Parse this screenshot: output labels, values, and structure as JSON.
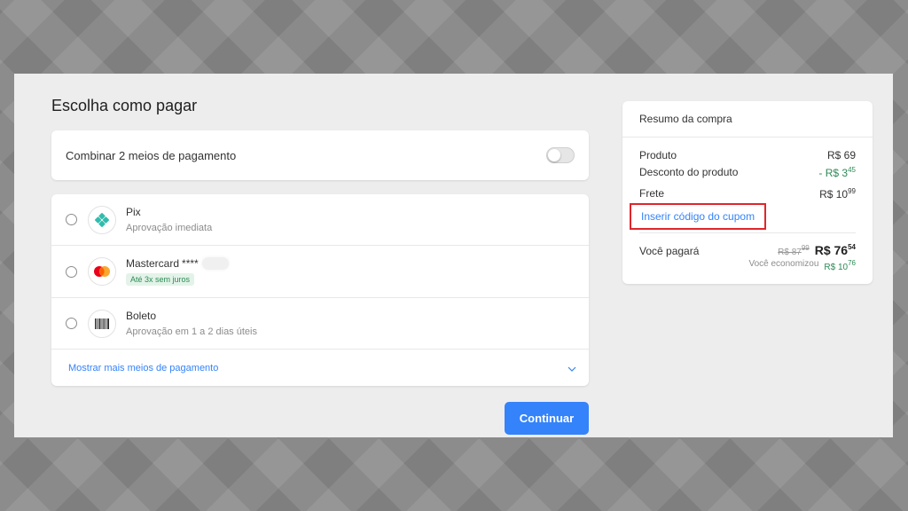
{
  "page": {
    "title": "Escolha como pagar"
  },
  "combine": {
    "label": "Combinar 2 meios de pagamento",
    "enabled": false
  },
  "methods": [
    {
      "name": "Pix",
      "subtitle": "Aprovação imediata",
      "icon": "pix-icon"
    },
    {
      "name": "Mastercard",
      "mask": "****",
      "badge": "Até 3x sem juros",
      "icon": "mastercard-icon"
    },
    {
      "name": "Boleto",
      "subtitle": "Aprovação em 1 a 2 dias úteis",
      "icon": "barcode-icon"
    }
  ],
  "more_methods": {
    "label": "Mostrar mais meios de pagamento",
    "icon": "chevron-down-icon"
  },
  "continue_label": "Continuar",
  "summary": {
    "title": "Resumo da compra",
    "product": {
      "label": "Produto",
      "value": "R$ 69"
    },
    "discount": {
      "label": "Desconto do produto",
      "value_main": "- R$ 3",
      "value_cents": "45"
    },
    "shipping": {
      "label": "Frete",
      "value_main": "R$ 10",
      "value_cents": "99"
    },
    "coupon_link": "Inserir código do cupom",
    "pay": {
      "label": "Você pagará",
      "old_main": "R$ 87",
      "old_cents": "99",
      "total_main": "R$ 76",
      "total_cents": "54"
    },
    "savings": {
      "label": "Você economizou",
      "value_main": "R$ 10",
      "value_cents": "76"
    }
  },
  "colors": {
    "accent": "#3483fa",
    "success": "#2d8a55",
    "highlight_border": "#e0262b",
    "pix": "#32bcad"
  }
}
